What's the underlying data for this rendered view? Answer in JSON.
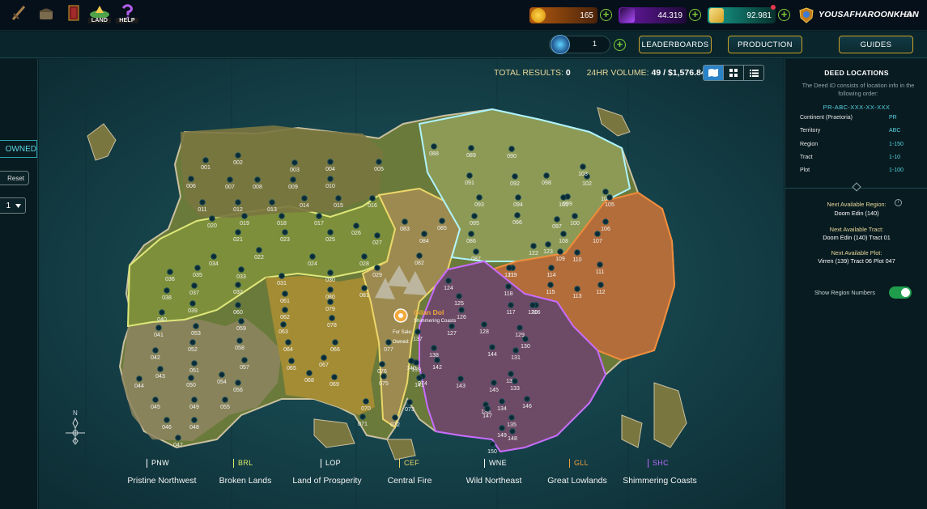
{
  "nav": {
    "land_label": "LAND",
    "help_label": "HELP"
  },
  "resources": {
    "dec": "165",
    "sps": "44.319",
    "credits": "92.981"
  },
  "user": {
    "name": "YOUSAFHAROONKHAN",
    "lang": "EN"
  },
  "subnav": {
    "dec_count": "1",
    "leaderboards": "LEADERBOARDS",
    "production": "PRODUCTION",
    "guides": "GUIDES"
  },
  "left": {
    "owned_label": "OWNED",
    "reset_label": "Reset",
    "page_value": "1"
  },
  "map": {
    "total_label": "TOTAL RESULTS:",
    "total_value": "0",
    "volume_label": "24HR VOLUME:",
    "volume_value": "49 / $1,576.84",
    "popup_title": "Gilan Dol",
    "popup_sub": "Shimmering Coasts",
    "popup_forsale": "For Sale:",
    "popup_owned": "Owned:",
    "compass_n": "N"
  },
  "legend": [
    {
      "code": "PNW",
      "name": "Pristine Northwest",
      "color": "#ffffff"
    },
    {
      "code": "BRL",
      "name": "Broken Lands",
      "color": "#d8e86a"
    },
    {
      "code": "LOP",
      "name": "Land of Prosperity",
      "color": "#ffffff"
    },
    {
      "code": "CEF",
      "name": "Central Fire",
      "color": "#e9d46a"
    },
    {
      "code": "WNE",
      "name": "Wild Northeast",
      "color": "#ffffff"
    },
    {
      "code": "GLL",
      "name": "Great Lowlands",
      "color": "#f0a040"
    },
    {
      "code": "SHC",
      "name": "Shimmering Coasts",
      "color": "#b46bff"
    }
  ],
  "regions": [
    "001",
    "002",
    "003",
    "004",
    "005",
    "006",
    "007",
    "008",
    "009",
    "010",
    "011",
    "012",
    "013",
    "014",
    "015",
    "016",
    "017",
    "018",
    "019",
    "020",
    "021",
    "022",
    "023",
    "024",
    "025",
    "026",
    "027",
    "028",
    "029",
    "030",
    "031",
    "032",
    "033",
    "034",
    "035",
    "036",
    "037",
    "038",
    "039",
    "040",
    "041",
    "042",
    "043",
    "044",
    "045",
    "046",
    "047",
    "048",
    "049",
    "050",
    "051",
    "052",
    "053",
    "054",
    "055",
    "056",
    "057",
    "058",
    "059",
    "060",
    "061",
    "062",
    "063",
    "064",
    "065",
    "066",
    "067",
    "068",
    "069",
    "070",
    "071",
    "072",
    "073",
    "074",
    "075",
    "076",
    "077",
    "078",
    "079",
    "080",
    "081",
    "082",
    "083",
    "084",
    "085",
    "086",
    "087",
    "088",
    "089",
    "090",
    "091",
    "092",
    "093",
    "094",
    "095",
    "096",
    "097",
    "098",
    "099",
    "100",
    "101",
    "102",
    "103",
    "104",
    "105",
    "106",
    "107",
    "108",
    "109",
    "110",
    "111",
    "112",
    "113",
    "114",
    "115",
    "116",
    "117",
    "118",
    "119",
    "120",
    "121",
    "122",
    "123",
    "124",
    "125",
    "126",
    "127",
    "128",
    "129",
    "130",
    "131",
    "132",
    "133",
    "134",
    "135",
    "136",
    "137",
    "138",
    "139",
    "140",
    "141",
    "142",
    "143",
    "144",
    "145",
    "146",
    "147",
    "148",
    "149",
    "150"
  ],
  "deed": {
    "title": "DEED LOCATIONS",
    "desc": "The Deed ID consists of location info in the following order:",
    "code": "PR-ABC-XXX-XX-XXX",
    "rows": [
      {
        "label": "Continent (Praetoria)",
        "value": "PR"
      },
      {
        "label": "Territory",
        "value": "ABC"
      },
      {
        "label": "Region",
        "value": "1-150"
      },
      {
        "label": "Tract",
        "value": "1-10"
      },
      {
        "label": "Plot",
        "value": "1-100"
      }
    ],
    "next_region_label": "Next Available Region:",
    "next_region_value": "Doom Edin (140)",
    "next_tract_label": "Next Available Tract:",
    "next_tract_value": "Doom Edin (140) Tract 01",
    "next_plot_label": "Next Available Plot:",
    "next_plot_value": "Virren (139) Tract 06 Plot 047",
    "toggle_label": "Show Region Numbers"
  }
}
